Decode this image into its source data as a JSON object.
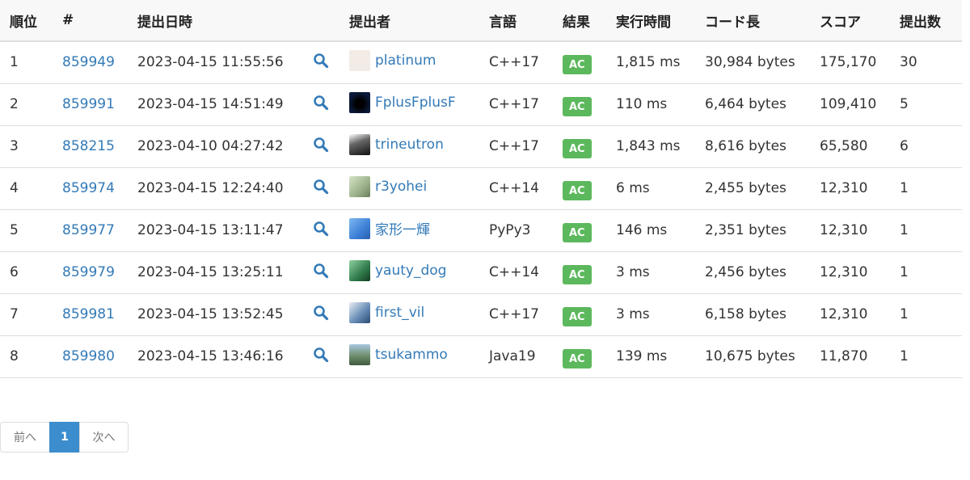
{
  "table": {
    "headers": {
      "rank": "順位",
      "id": "#",
      "time": "提出日時",
      "user": "提出者",
      "lang": "言語",
      "result": "結果",
      "exec": "実行時間",
      "length": "コード長",
      "score": "スコア",
      "count": "提出数"
    },
    "rows": [
      {
        "rank": "1",
        "id": "859949",
        "time": "2023-04-15 11:55:56",
        "user": "platinum",
        "avatar_icon": "rabbit-avatar-icon",
        "avatar_color": "#f3ece6",
        "lang": "C++17",
        "result": "AC",
        "exec": "1,815 ms",
        "length": "30,984 bytes",
        "score": "175,170",
        "count": "30"
      },
      {
        "rank": "2",
        "id": "859991",
        "time": "2023-04-15 14:51:49",
        "user": "FplusFplusF",
        "avatar_icon": "dark-orb-avatar-icon",
        "avatar_color": "#0b1a3a",
        "lang": "C++17",
        "result": "AC",
        "exec": "110 ms",
        "length": "6,464 bytes",
        "score": "109,410",
        "count": "5"
      },
      {
        "rank": "3",
        "id": "858215",
        "time": "2023-04-10 04:27:42",
        "user": "trineutron",
        "avatar_icon": "crystal-avatar-icon",
        "avatar_color": "#444444",
        "lang": "C++17",
        "result": "AC",
        "exec": "1,843 ms",
        "length": "8,616 bytes",
        "score": "65,580",
        "count": "6"
      },
      {
        "rank": "4",
        "id": "859974",
        "time": "2023-04-15 12:24:40",
        "user": "r3yohei",
        "avatar_icon": "character-avatar-icon",
        "avatar_color": "#9bb08a",
        "lang": "C++14",
        "result": "AC",
        "exec": "6 ms",
        "length": "2,455 bytes",
        "score": "12,310",
        "count": "1"
      },
      {
        "rank": "5",
        "id": "859977",
        "time": "2023-04-15 13:11:47",
        "user": "家形一輝",
        "avatar_icon": "blue-swirl-avatar-icon",
        "avatar_color": "#4a90e2",
        "lang": "PyPy3",
        "result": "AC",
        "exec": "146 ms",
        "length": "2,351 bytes",
        "score": "12,310",
        "count": "1"
      },
      {
        "rank": "6",
        "id": "859979",
        "time": "2023-04-15 13:25:11",
        "user": "yauty_dog",
        "avatar_icon": "green-gradient-avatar-icon",
        "avatar_color": "#2f7a4a",
        "lang": "C++14",
        "result": "AC",
        "exec": "3 ms",
        "length": "2,456 bytes",
        "score": "12,310",
        "count": "1"
      },
      {
        "rank": "7",
        "id": "859981",
        "time": "2023-04-15 13:52:45",
        "user": "first_vil",
        "avatar_icon": "anime-avatar-icon",
        "avatar_color": "#6a8fb8",
        "lang": "C++17",
        "result": "AC",
        "exec": "3 ms",
        "length": "6,158 bytes",
        "score": "12,310",
        "count": "1"
      },
      {
        "rank": "8",
        "id": "859980",
        "time": "2023-04-15 13:46:16",
        "user": "tsukammo",
        "avatar_icon": "landscape-avatar-icon",
        "avatar_color": "#5b7f5a",
        "lang": "Java19",
        "result": "AC",
        "exec": "139 ms",
        "length": "10,675 bytes",
        "score": "11,870",
        "count": "1"
      }
    ]
  },
  "pagination": {
    "prev": "前へ",
    "current": "1",
    "next": "次へ"
  },
  "colors": {
    "link": "#337ab7",
    "ac_badge": "#5cb85c",
    "active_page": "#3c8dcd",
    "header_bg": "#f8f8f8"
  },
  "icons": {
    "detail": "magnifier-icon"
  }
}
